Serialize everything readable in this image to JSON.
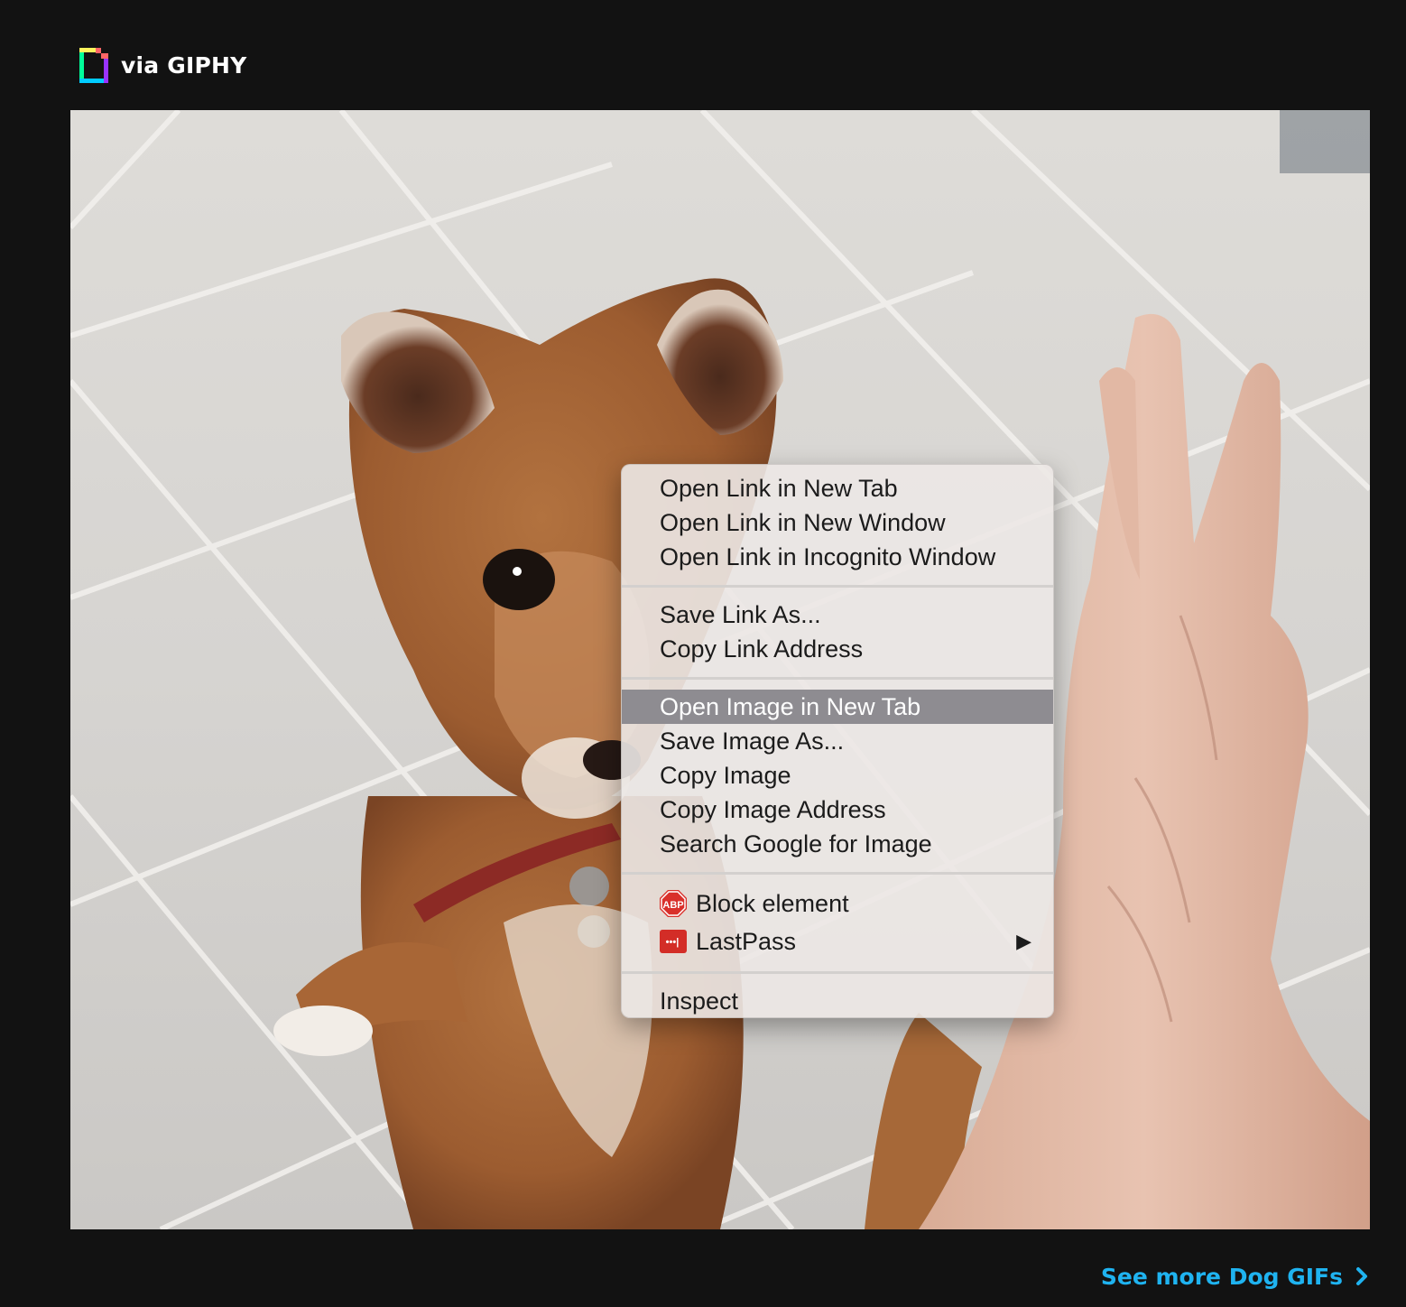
{
  "header": {
    "via_text": "via GIPHY",
    "logo_icon": "giphy-logo-icon"
  },
  "gif": {
    "icon": "shiba-puppy-high-five-image"
  },
  "context_menu": {
    "groups": [
      [
        "Open Link in New Tab",
        "Open Link in New Window",
        "Open Link in Incognito Window"
      ],
      [
        "Save Link As...",
        "Copy Link Address"
      ],
      [
        "Open Image in New Tab",
        "Save Image As...",
        "Copy Image",
        "Copy Image Address",
        "Search Google for Image"
      ],
      [
        "Block element",
        "LastPass"
      ],
      [
        "Inspect"
      ]
    ],
    "highlighted_item": "Open Image in New Tab",
    "abp_icon_text": "ABP",
    "lastpass_icon_text": "•••|",
    "submenu_arrow": "▶",
    "highlight_color": "#8e8c91"
  },
  "footer": {
    "see_more": "See more Dog GIFs",
    "link_color": "#1fb3f0",
    "chevron_icon": "chevron-right-icon"
  }
}
